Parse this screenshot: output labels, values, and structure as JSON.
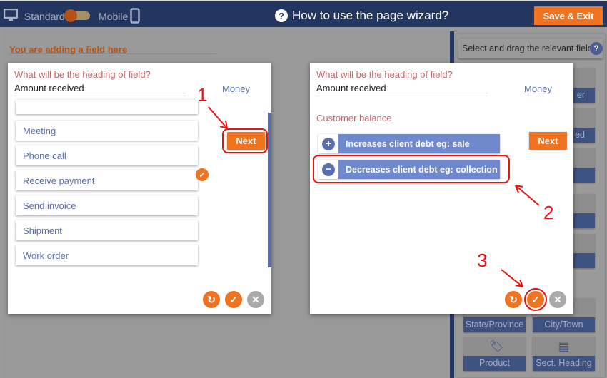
{
  "header": {
    "standard": "Standard",
    "mobile": "Mobile",
    "title": "How to use the page wizard?",
    "save": "Save & Exit"
  },
  "left": {
    "adding": "You are adding a field here",
    "question": "What will be the heading of field?",
    "value": "Amount received",
    "type": "Money",
    "next": "Next",
    "items": [
      "Meeting",
      "Phone call",
      "Receive payment",
      "Send invoice",
      "Shipment",
      "Work order"
    ],
    "selected": "Receive payment"
  },
  "right": {
    "question": "What will be the heading of field?",
    "value": "Amount received",
    "type": "Money",
    "section": "Customer balance",
    "next": "Next",
    "options": [
      {
        "icon": "plus-icon",
        "label": "Increases client debt eg: sale"
      },
      {
        "icon": "minus-icon",
        "label": "Decreases client debt eg: collection"
      }
    ]
  },
  "palette": {
    "hint": "Select and drag the relevant field",
    "tiles": [
      "",
      "er",
      "",
      "ed",
      "",
      "",
      "State/Province",
      "City/Town",
      "Product",
      "Sect. Heading"
    ]
  },
  "annotations": [
    "1",
    "2",
    "3"
  ],
  "colors": {
    "header": "#233660",
    "accent": "#f07320",
    "option": "#6f89cc"
  }
}
